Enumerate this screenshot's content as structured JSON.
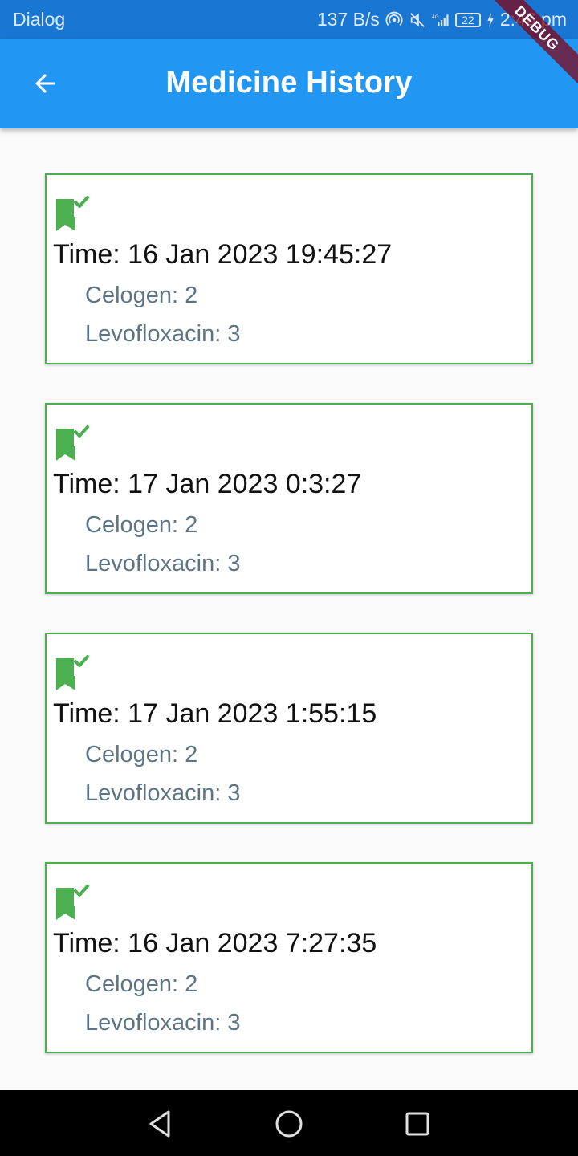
{
  "status_bar": {
    "app_label": "Dialog",
    "speed": "137 B/s",
    "network": "4G",
    "battery": "22",
    "time": "2:46 pm"
  },
  "app_bar": {
    "title": "Medicine History",
    "back_icon": "arrow-back-icon"
  },
  "debug_banner": "DEBUG",
  "colors": {
    "status_bar": "#1976d2",
    "app_bar": "#2196f3",
    "card_border": "#4caf50",
    "icon": "#4caf50",
    "secondary_text": "#5d7485"
  },
  "history": [
    {
      "time": "Time: 16 Jan 2023 19:45:27",
      "medicines": [
        "Celogen: 2",
        "Levofloxacin: 3"
      ]
    },
    {
      "time": "Time: 17 Jan 2023 0:3:27",
      "medicines": [
        "Celogen: 2",
        "Levofloxacin: 3"
      ]
    },
    {
      "time": "Time: 17 Jan 2023 1:55:15",
      "medicines": [
        "Celogen: 2",
        "Levofloxacin: 3"
      ]
    },
    {
      "time": "Time: 16 Jan 2023 7:27:35",
      "medicines": [
        "Celogen: 2",
        "Levofloxacin: 3"
      ]
    }
  ],
  "nav_bar": {
    "buttons": [
      "back-triangle-icon",
      "home-circle-icon",
      "recents-square-icon"
    ]
  }
}
